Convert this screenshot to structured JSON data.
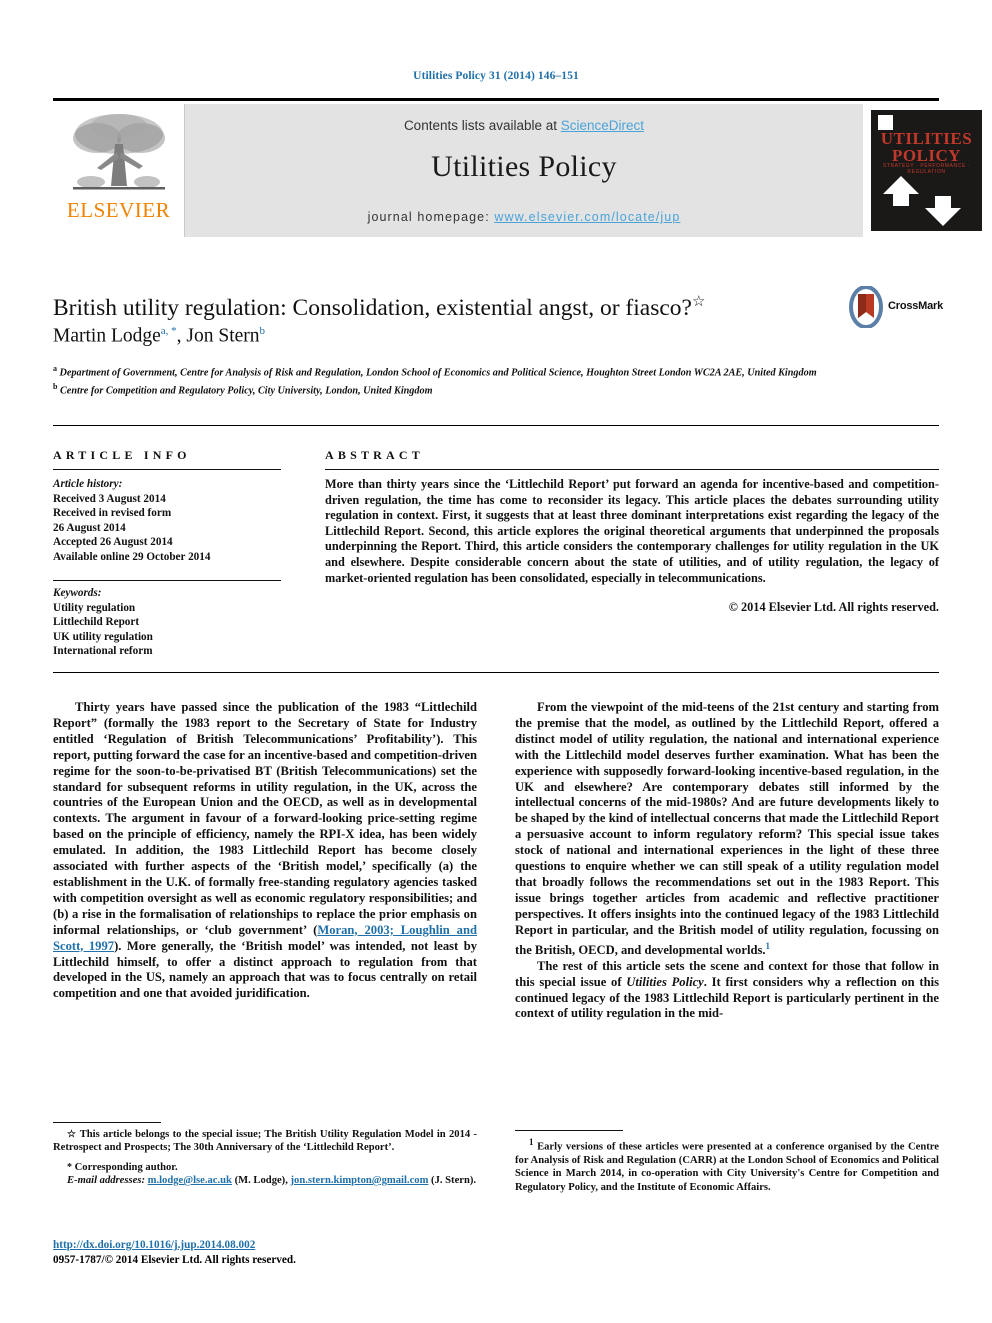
{
  "running_head": "Utilities Policy 31 (2014) 146–151",
  "masthead": {
    "contents_prefix": "Contents lists available at ",
    "contents_link": "ScienceDirect",
    "journal_name": "Utilities Policy",
    "homepage_prefix": "journal homepage: ",
    "homepage_url": "www.elsevier.com/locate/jup",
    "publisher_wordmark": "ELSEVIER",
    "cover": {
      "line1": "UTILITIES",
      "line2": "POLICY",
      "subtitle": "STRATEGY · PERFORMANCE · REGULATION"
    }
  },
  "article": {
    "title": "British utility regulation: Consolidation, existential angst, or fiasco?",
    "title_marker": "☆",
    "authors_text": "Martin Lodge",
    "author1_sup": "a, *",
    "authors_sep": ", Jon Stern",
    "author2_sup": "b",
    "affiliation_a_mark": "a",
    "affiliation_a": "Department of Government, Centre for Analysis of Risk and Regulation, London School of Economics and Political Science, Houghton Street London WC2A 2AE, United Kingdom",
    "affiliation_b_mark": "b",
    "affiliation_b": "Centre for Competition and Regulatory Policy, City University, London, United Kingdom",
    "crossmark_label": "CrossMark"
  },
  "info": {
    "heading": "ARTICLE INFO",
    "history_label": "Article history:",
    "history_lines": [
      "Received 3 August 2014",
      "Received in revised form",
      "26 August 2014",
      "Accepted 26 August 2014",
      "Available online 29 October 2014"
    ],
    "keywords_label": "Keywords:",
    "keywords": [
      "Utility regulation",
      "Littlechild Report",
      "UK utility regulation",
      "International reform"
    ]
  },
  "abstract": {
    "heading": "ABSTRACT",
    "text": "More than thirty years since the ‘Littlechild Report’ put forward an agenda for incentive-based and competition-driven regulation, the time has come to reconsider its legacy. This article places the debates surrounding utility regulation in context. First, it suggests that at least three dominant interpretations exist regarding the legacy of the Littlechild Report. Second, this article explores the original theoretical arguments that underpinned the proposals underpinning the Report. Third, this article considers the contemporary challenges for utility regulation in the UK and elsewhere. Despite considerable concern about the state of utilities, and of utility regulation, the legacy of market-oriented regulation has been consolidated, especially in telecommunications.",
    "copyright": "© 2014 Elsevier Ltd. All rights reserved."
  },
  "body": {
    "left_p1_a": "Thirty years have passed since the publication of the 1983 “Littlechild Report” (formally the 1983 report to the Secretary of State for Industry entitled ‘Regulation of British Telecommunications’ Profitability’). This report, putting forward the case for an incentive-based and competition-driven regime for the soon-to-be-privatised BT (British Telecommunications) set the standard for subsequent reforms in utility regulation, in the UK, across the countries of the European Union and the OECD, as well as in developmental contexts. The argument in favour of a forward-looking price-setting regime based on the principle of efficiency, namely the RPI-X idea, has been widely emulated. In addition, the 1983 Littlechild Report has become closely associated with further aspects of the ‘British model,’ specifically (a) the establishment in the U.K. of formally free-standing regulatory agencies tasked with competition oversight as well as economic regulatory responsibilities; and (b) a rise in the formalisation of relationships to replace the prior emphasis on informal relationships, or ‘club government’ (",
    "left_p1_cite": "Moran, 2003; Loughlin and Scott, 1997",
    "left_p1_b": "). More generally, the ‘British model’ was intended, not least by Littlechild himself, to offer a distinct approach to regulation from that developed in the US, namely an approach that was to focus centrally on retail competition and one that avoided juridification.",
    "right_p1_a": "From the viewpoint of the mid-teens of the 21st century and starting from the premise that the model, as outlined by the Littlechild Report, offered a distinct model of utility regulation, the national and international experience with the Littlechild model deserves further examination. What has been the experience with supposedly forward-looking incentive-based regulation, in the UK and elsewhere? Are contemporary debates still informed by the intellectual concerns of the mid-1980s? And are future developments likely to be shaped by the kind of intellectual concerns that made the Littlechild Report a persuasive account to inform regulatory reform? This special issue takes stock of national and international experiences in the light of these three questions to enquire whether we can still speak of a utility regulation model that broadly follows the recommendations set out in the 1983 Report. This issue brings together articles from academic and reflective practitioner perspectives. It offers insights into the continued legacy of the 1983 Littlechild Report in particular, and the British model of utility regulation, focussing on the British, OECD, and developmental worlds.",
    "right_p1_fn": "1",
    "right_p2_a": "The rest of this article sets the scene and context for those that follow in this special issue of ",
    "right_p2_italic": "Utilities Policy",
    "right_p2_b": ". It first considers why a reflection on this continued legacy of the 1983 Littlechild Report is particularly pertinent in the context of utility regulation in the mid-"
  },
  "footnotes": {
    "star_mark": "☆",
    "star_text": "This article belongs to the special issue; The British Utility Regulation Model in 2014 - Retrospect and Prospects; The 30th Anniversary of the ‘Littlechild Report’.",
    "corr_mark": "*",
    "corr_text": "Corresponding author.",
    "email_label": "E-mail addresses:",
    "email1": "m.lodge@lse.ac.uk",
    "email1_owner": "(M. Lodge),",
    "email2": "jon.stern.kimpton@gmail.com",
    "email2_owner": "(J. Stern).",
    "right_mark": "1",
    "right_text": "Early versions of these articles were presented at a conference organised by the Centre for Analysis of Risk and Regulation (CARR) at the London School of Economics and Political Science in March 2014, in co-operation with City University's Centre for Competition and Regulatory Policy, and the Institute of Economic Affairs."
  },
  "doi": {
    "url": "http://dx.doi.org/10.1016/j.jup.2014.08.002",
    "issn_line": "0957-1787/© 2014 Elsevier Ltd. All rights reserved."
  }
}
